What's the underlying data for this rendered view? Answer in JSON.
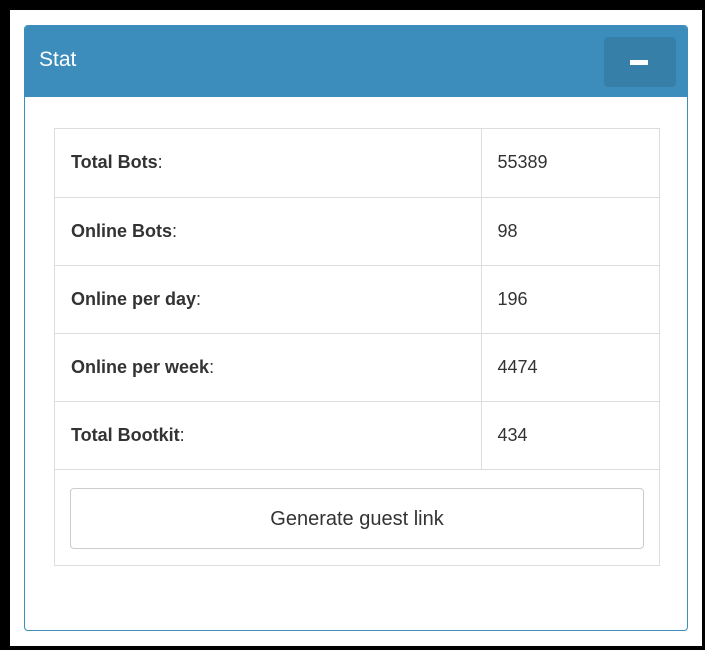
{
  "panel": {
    "title": "Stat",
    "collapse_icon": "minus-icon",
    "header_color": "#3c8dbc",
    "button_color": "#367fa9"
  },
  "stats": [
    {
      "label": "Total Bots",
      "value": "55389"
    },
    {
      "label": "Online Bots",
      "value": "98"
    },
    {
      "label": "Online per day",
      "value": "196"
    },
    {
      "label": "Online per week",
      "value": "4474"
    },
    {
      "label": "Total Bootkit",
      "value": "434"
    }
  ],
  "colon": ":",
  "guest_button_label": "Generate guest link"
}
